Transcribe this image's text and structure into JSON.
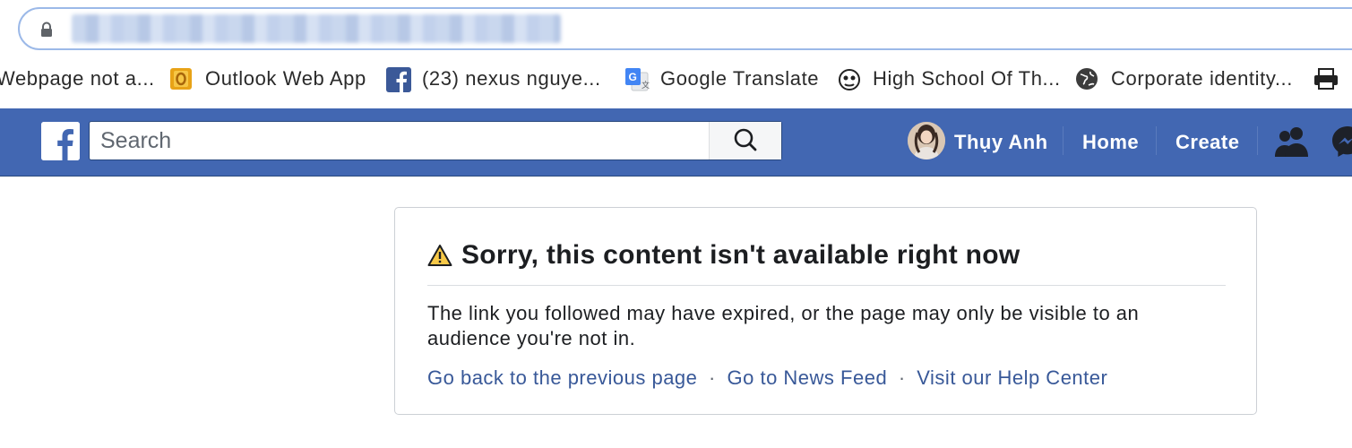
{
  "browser": {
    "url_obscured": true
  },
  "bookmarks": [
    {
      "label": "Webpage not a...",
      "icon": "page-icon"
    },
    {
      "label": "Outlook Web App",
      "icon": "outlook-icon"
    },
    {
      "label": "(23) nexus nguye...",
      "icon": "facebook-icon"
    },
    {
      "label": "Google Translate",
      "icon": "google-translate-icon"
    },
    {
      "label": "High School Of Th...",
      "icon": "mascot-icon"
    },
    {
      "label": "Corporate identity...",
      "icon": "globe-icon"
    }
  ],
  "facebook": {
    "brand_color": "#4267b2",
    "search_placeholder": "Search",
    "user_name": "Thụy Anh",
    "nav": {
      "home": "Home",
      "create": "Create"
    }
  },
  "error": {
    "title": "Sorry, this content isn't available right now",
    "message": "The link you followed may have expired, or the page may only be visible to an audience you're not in.",
    "links": {
      "back": "Go back to the previous page",
      "feed": "Go to News Feed",
      "help": "Visit our Help Center"
    },
    "separator": "·"
  }
}
